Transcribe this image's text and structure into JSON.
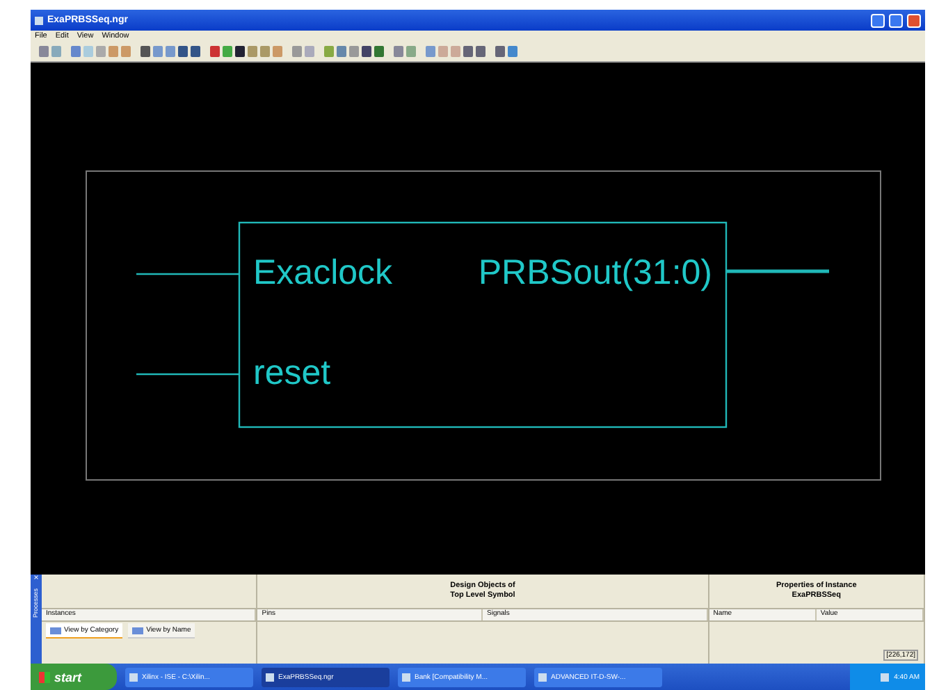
{
  "window": {
    "title": "ExaPRBSSeq.ngr"
  },
  "menu": [
    "File",
    "Edit",
    "View",
    "Window"
  ],
  "schematic": {
    "inputs": [
      "Exaclock",
      "reset"
    ],
    "outputs": [
      "PRBSout(31:0)"
    ]
  },
  "side_tab": {
    "close": "×",
    "label": "Processes"
  },
  "instances": {
    "label": "Instances",
    "tabs": [
      {
        "label": "View by Category",
        "selected": true
      },
      {
        "label": "View by Name",
        "selected": false
      }
    ]
  },
  "design_objects": {
    "title": "Design Objects of",
    "subtitle": "Top Level Symbol",
    "columns": [
      "Pins",
      "Signals"
    ]
  },
  "properties": {
    "title": "Properties of Instance",
    "subtitle": "ExaPRBSSeq",
    "columns": [
      "Name",
      "Value"
    ]
  },
  "status": "[226,172]",
  "taskbar": {
    "start": "start",
    "tasks": [
      {
        "label": "Xilinx - ISE - C:\\Xilin...",
        "selected": false
      },
      {
        "label": "ExaPRBSSeq.ngr",
        "selected": true
      },
      {
        "label": "Bank [Compatibility M...",
        "selected": false
      },
      {
        "label": "ADVANCED IT-D-SW-...",
        "selected": false
      }
    ],
    "clock": "4:40 AM"
  }
}
